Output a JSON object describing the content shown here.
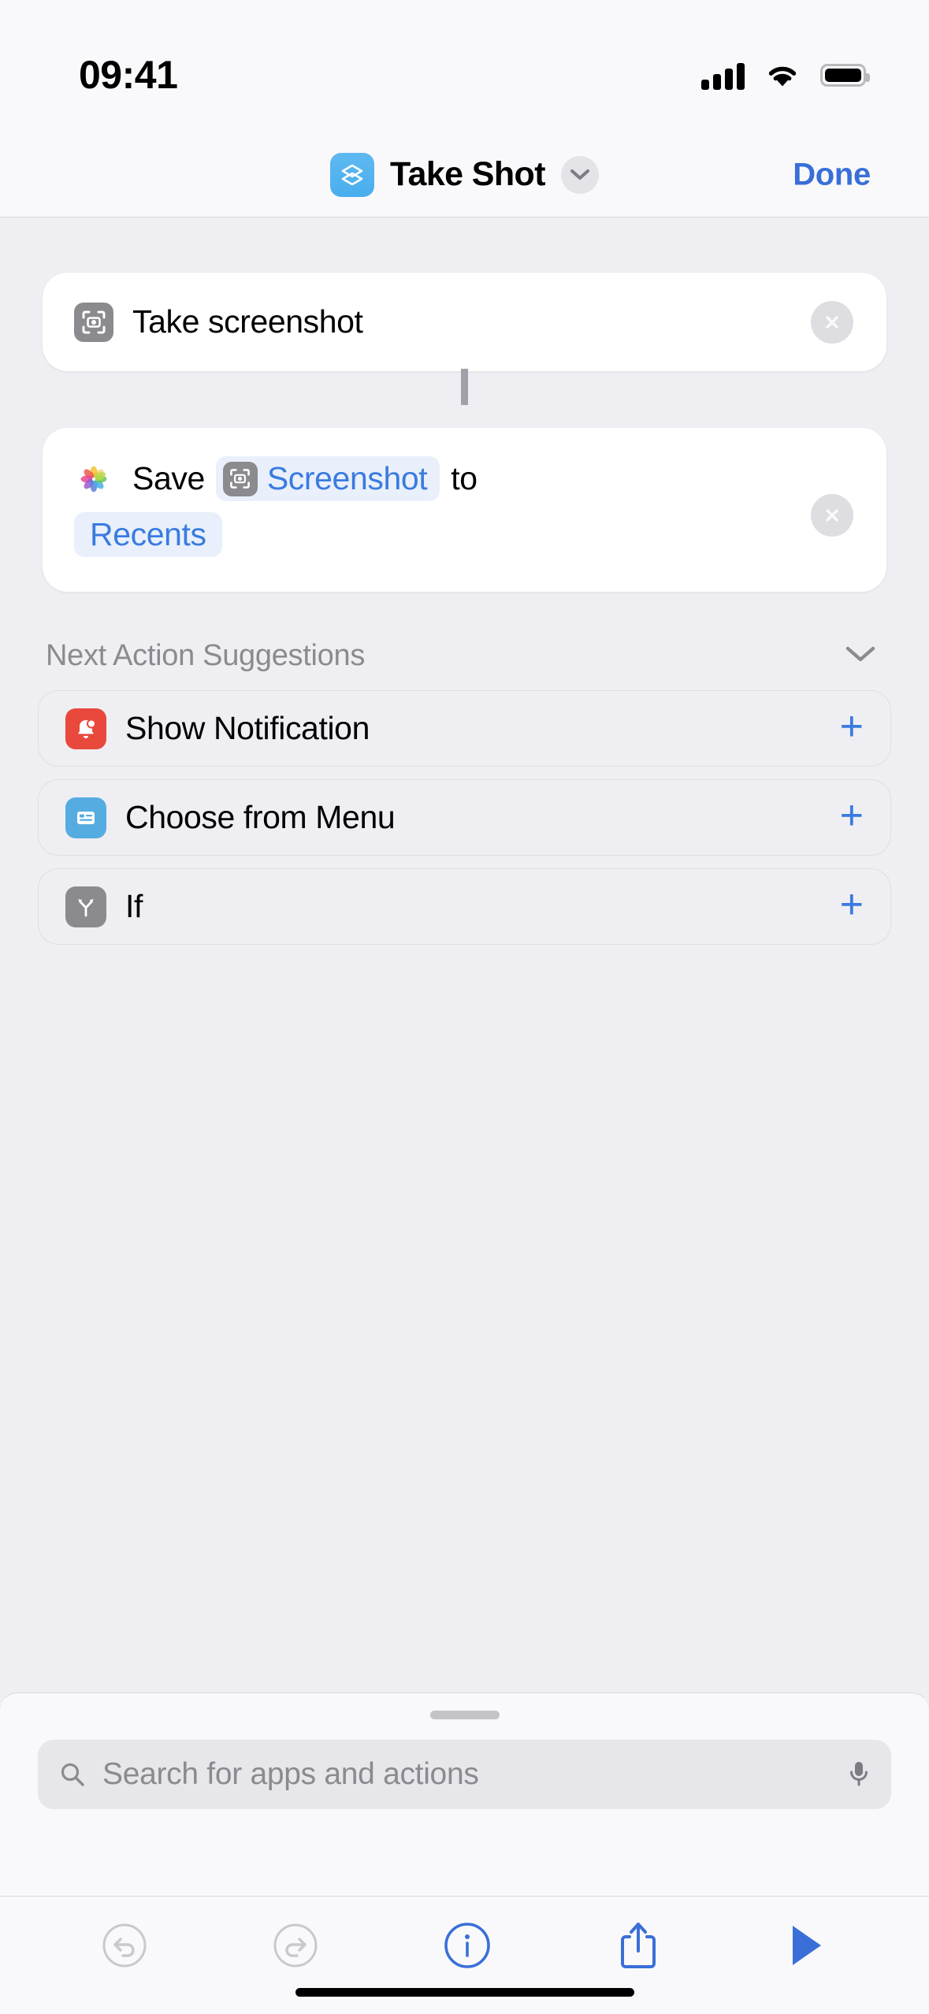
{
  "status_bar": {
    "time": "09:41",
    "cellular_icon": "cellular-signal-icon",
    "wifi_icon": "wifi-icon",
    "battery_icon": "battery-full-icon"
  },
  "nav_bar": {
    "shortcut_icon": "layers-icon",
    "title": "Take Shot",
    "chevron_icon": "chevron-down-icon",
    "done_label": "Done"
  },
  "actions": [
    {
      "icon": "screenshot-camera-icon",
      "text": "Take screenshot",
      "delete_icon": "close-circle-icon"
    },
    {
      "icon": "photos-app-icon",
      "prefix": "Save",
      "variable_icon": "screenshot-camera-icon",
      "variable": "Screenshot",
      "middle": "to",
      "destination": "Recents",
      "delete_icon": "close-circle-icon"
    }
  ],
  "suggestions": {
    "header": "Next Action Suggestions",
    "collapse_icon": "chevron-down-icon",
    "items": [
      {
        "icon": "bell-notification-icon",
        "label": "Show Notification",
        "add_icon": "plus-icon",
        "add_label": "+"
      },
      {
        "icon": "menu-list-icon",
        "label": "Choose from Menu",
        "add_icon": "plus-icon",
        "add_label": "+"
      },
      {
        "icon": "branch-if-icon",
        "label": "If",
        "add_icon": "plus-icon",
        "add_label": "+"
      }
    ]
  },
  "search": {
    "icon": "search-icon",
    "placeholder": "Search for apps and actions",
    "mic_icon": "microphone-icon"
  },
  "toolbar": {
    "undo_icon": "undo-icon",
    "redo_icon": "redo-icon",
    "info_icon": "info-circle-icon",
    "share_icon": "share-icon",
    "run_icon": "play-icon"
  },
  "colors": {
    "accent_blue": "#3A7BE0",
    "done_blue": "#3A6FD8",
    "page_bg": "#EFEFF3",
    "card_bg": "#FFFFFF",
    "chrome_bg": "#F9F9FB",
    "token_bg": "#E9F0FB",
    "icon_gray": "#8A8A8F",
    "icon_red": "#E8493C",
    "icon_blue": "#55ACE0",
    "shortcut_blue": "#49AEEE"
  }
}
